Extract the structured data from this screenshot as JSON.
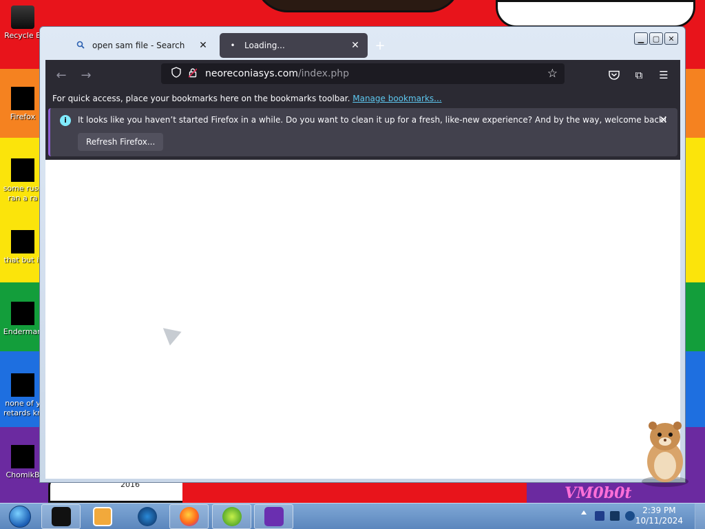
{
  "desktop": {
    "icons": [
      {
        "label": "Recycle B",
        "label2": ""
      },
      {
        "label": "Firefox",
        "label2": ""
      },
      {
        "label": "some russ",
        "label2": "ran a ra"
      },
      {
        "label": "that but it",
        "label2": ""
      },
      {
        "label": "Enderman",
        "label2": ""
      },
      {
        "label": "none of y",
        "label2": "retards kn"
      },
      {
        "label": "ChomikB",
        "label2": ""
      }
    ],
    "wallpaper_text_year": "2016",
    "wallpaper_text_brand": "VM0b0t"
  },
  "browser": {
    "tabs": [
      {
        "title": "open sam file - Search",
        "icon": "search-icon"
      },
      {
        "title": "Loading...",
        "icon": "loading-dot-icon"
      }
    ],
    "new_tab_label": "+",
    "url_host": "neoreconiasys.com",
    "url_path": "/index.php",
    "bookmarks_text": "For quick access, place your bookmarks here on the bookmarks toolbar.",
    "bookmarks_link": "Manage bookmarks...",
    "notification": {
      "message": "It looks like you haven’t started Firefox in a while. Do you want to clean it up for a fresh, like-new experience? And by the way, welcome back!",
      "button": "Refresh Firefox..."
    }
  },
  "taskbar": {
    "clock_time": "2:39 PM",
    "clock_date": "10/11/2024"
  },
  "colors": {
    "firefox_dark": "#2b2a33",
    "tab_active": "#42414d",
    "link": "#5ec8f0",
    "info_accent": "#80ebff"
  }
}
